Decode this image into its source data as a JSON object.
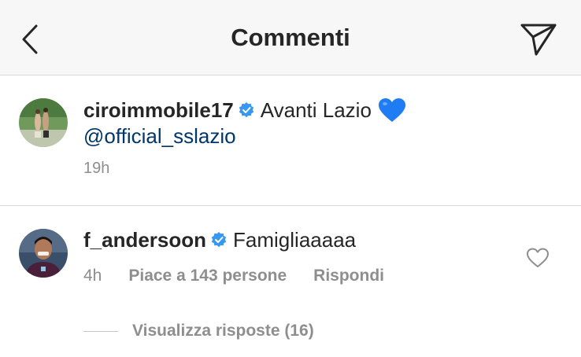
{
  "header": {
    "title": "Commenti",
    "back_icon": "chevron-left-icon",
    "send_icon": "paper-plane-icon"
  },
  "caption": {
    "username": "ciroimmobile17",
    "text": "Avanti Lazio",
    "emoji": "blue-heart",
    "mention": "@official_sslazio",
    "time": "19h"
  },
  "comment": {
    "username": "f_andersoon",
    "text": "Famigliaaaaa",
    "time": "4h",
    "likes": "Piace a 143 persone",
    "reply": "Rispondi",
    "view_replies": "Visualizza risposte (16)"
  },
  "colors": {
    "verified": "#3897f0",
    "link": "#00376b",
    "muted": "#8e8e8e",
    "text": "#262626",
    "header_bg": "#f7f7f7",
    "heart_emoji": "#1f7cf2"
  }
}
